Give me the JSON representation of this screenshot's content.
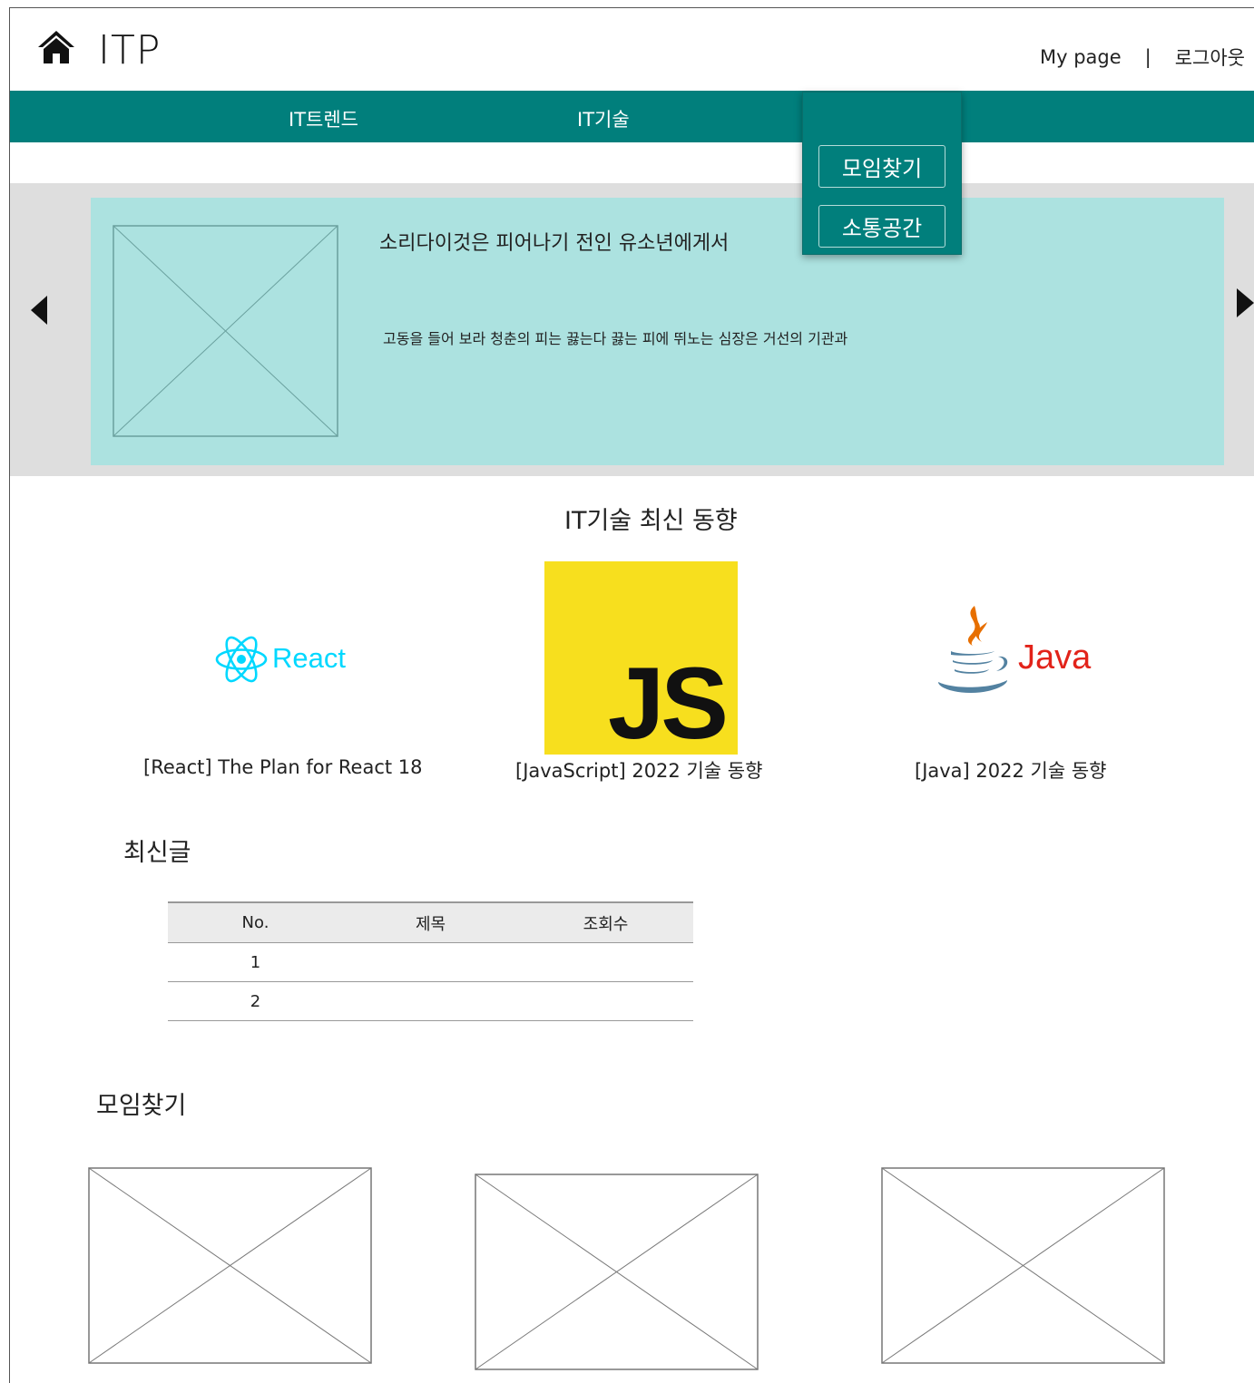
{
  "header": {
    "logo": "ITP",
    "home_icon": "home-icon",
    "mypage": "My page",
    "separator": "|",
    "logout": "로그아웃"
  },
  "nav": {
    "items": [
      "IT트렌드",
      "IT기술"
    ],
    "dropdown": [
      "모임찾기",
      "소통공간"
    ],
    "color": "#017f7c"
  },
  "banner": {
    "title": "소리다이것은 피어나기 전인 유소년에게서",
    "desc": "고동을 들어 보라 청춘의 피는 끓는다 끓는 피에 뛰노는 심장은 거선의 기관과",
    "bg": "#ace2e0",
    "prev_icon": "triangle-left-icon",
    "next_icon": "triangle-right-icon"
  },
  "trends": {
    "title": "IT기술 최신 동향",
    "cards": [
      {
        "logo_text": "React",
        "caption": "[React] The Plan for React 18"
      },
      {
        "logo_text": "JS",
        "caption": "[JavaScript] 2022 기술 동향"
      },
      {
        "logo_text": "Java",
        "caption": "[Java] 2022 기술 동향"
      }
    ]
  },
  "latest": {
    "title": "최신글",
    "columns": [
      "No.",
      "제목",
      "조회수"
    ],
    "rows": [
      [
        "1",
        "",
        ""
      ],
      [
        "2",
        "",
        ""
      ]
    ]
  },
  "groups": {
    "title": "모임찾기"
  }
}
